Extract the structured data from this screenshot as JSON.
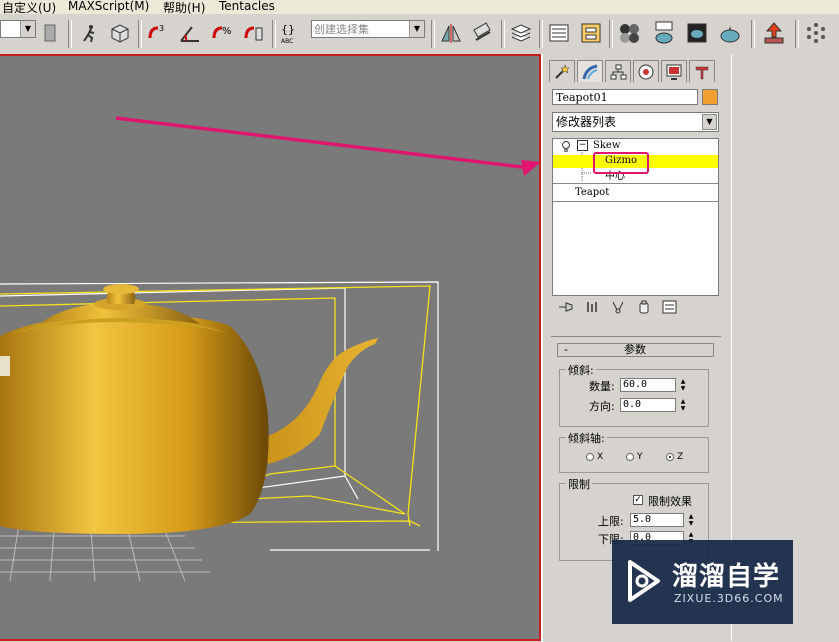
{
  "menu": {
    "items": [
      "自定义(U)",
      "MAXScript(M)",
      "帮助(H)",
      "Tentacles"
    ]
  },
  "toolbar": {
    "selection_set_placeholder": "创建选择集"
  },
  "command_panel": {
    "object_name": "Teapot01",
    "object_color": "#f0a030",
    "modifier_list_label": "修改器列表",
    "stack": {
      "items": [
        {
          "label": "Skew",
          "type": "modifier"
        },
        {
          "label": "Gizmo",
          "type": "sub-object",
          "selected": true
        },
        {
          "label": "中心",
          "type": "sub-object"
        },
        {
          "label": "Teapot",
          "type": "base-object"
        }
      ]
    }
  },
  "params": {
    "rollout_title": "参数",
    "rollout_collapse": "-",
    "skew_group": "倾斜:",
    "amount_label": "数量:",
    "amount_value": "60.0",
    "direction_label": "方向:",
    "direction_value": "0.0",
    "axis_group": "倾斜轴:",
    "axis_options": [
      "X",
      "Y",
      "Z"
    ],
    "axis_selected": "Z",
    "limit_group": "限制",
    "limit_effect_label": "限制效果",
    "limit_effect_checked": true,
    "upper_label": "上限:",
    "upper_value": "5.0",
    "lower_label": "下限:",
    "lower_value": "0.0"
  },
  "watermark": {
    "brand": "溜溜自学",
    "url": "ZIXUE.3D66.COM"
  },
  "colors": {
    "viewport_bg": "#7a7a7a",
    "active_border": "#c81e1e",
    "highlight": "#ffff00",
    "annotation": "#e0156e",
    "teapot": "#d9a520"
  }
}
